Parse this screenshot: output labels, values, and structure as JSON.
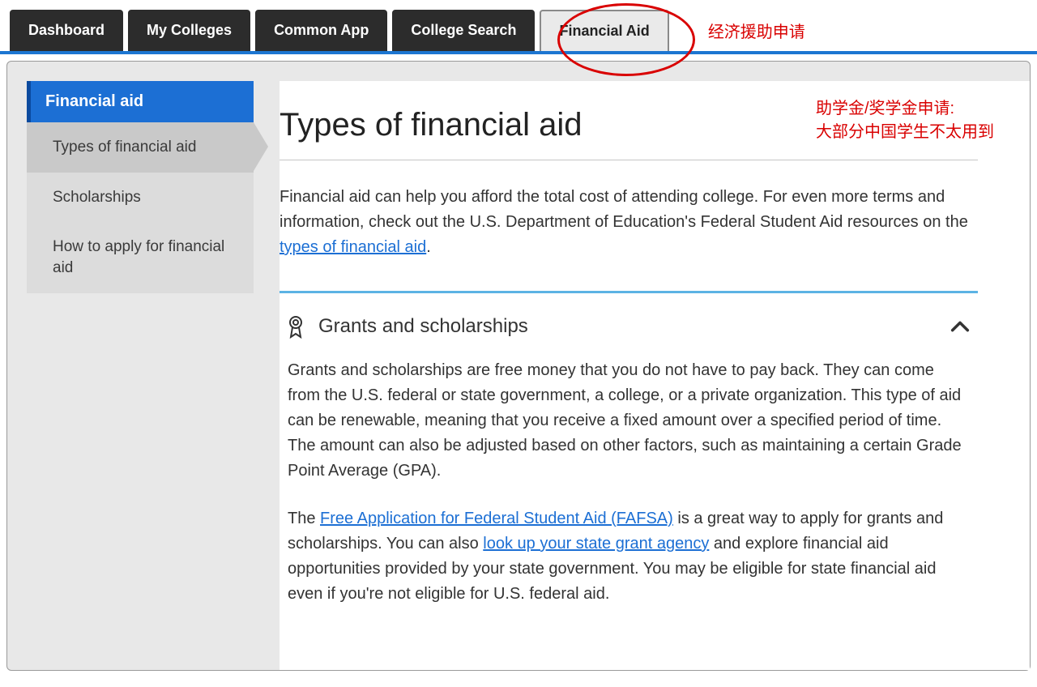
{
  "topnav": {
    "tabs": [
      {
        "label": "Dashboard",
        "active": false
      },
      {
        "label": "My Colleges",
        "active": false
      },
      {
        "label": "Common App",
        "active": false
      },
      {
        "label": "College Search",
        "active": false
      },
      {
        "label": "Financial Aid",
        "active": true
      }
    ]
  },
  "annotations": {
    "tab_note": "经济援助申请",
    "content_note_line1": "助学金/奖学金申请:",
    "content_note_line2": "大部分中国学生不太用到"
  },
  "sidebar": {
    "heading": "Financial aid",
    "items": [
      {
        "label": "Types of financial aid",
        "active": true
      },
      {
        "label": "Scholarships",
        "active": false
      },
      {
        "label": "How to apply for financial aid",
        "active": false
      }
    ]
  },
  "content": {
    "title": "Types of financial aid",
    "intro_before_link": "Financial aid can help you afford the total cost of attending college. For even more terms and information, check out the U.S. Department of Education's Federal Student Aid resources on the ",
    "intro_link": "types of financial aid",
    "intro_after_link": ".",
    "accordion": {
      "title": "Grants and scholarships",
      "expanded": true,
      "p1": "Grants and scholarships are free money that you do not have to pay back. They can come from the U.S. federal or state government, a college, or a private organization. This type of aid can be renewable, meaning that you receive a fixed amount over a specified period of time. The amount can also be adjusted based on other factors, such as maintaining a certain Grade Point Average (GPA).",
      "p2_a": "The ",
      "p2_link1": "Free Application for Federal Student Aid (FAFSA)",
      "p2_b": " is a great way to apply for grants and scholarships. You can also ",
      "p2_link2": "look up your state grant agency",
      "p2_c": " and explore financial aid opportunities provided by your state government. You may be eligible for state financial aid even if you're not eligible for U.S. federal aid."
    }
  }
}
